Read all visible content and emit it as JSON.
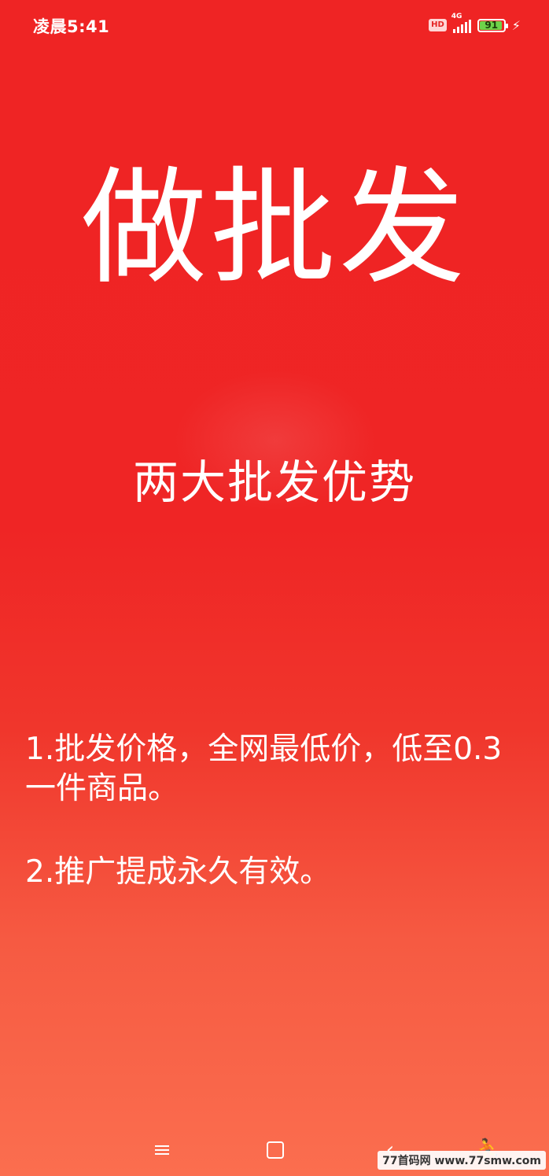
{
  "status_bar": {
    "time": "凌晨5:41",
    "hd_label": "HD",
    "network": "4G",
    "battery_level": "91"
  },
  "content": {
    "headline": "做批发",
    "subtitle": "两大批发优势",
    "points": [
      "1.批发价格，全网最低价，低至0.3一件商品。",
      "2.推广提成永久有效。"
    ]
  },
  "watermark": "77首码网 www.77smw.com",
  "icons": {
    "status": [
      "hd-icon",
      "signal-icon",
      "battery-icon",
      "charging-icon"
    ],
    "navigation": [
      "menu-icon",
      "home-icon",
      "back-icon",
      "accessibility-icon"
    ]
  },
  "colors": {
    "background_top": "#ef2424",
    "background_bottom": "#fb6e4f",
    "text": "#ffffff",
    "battery_fill": "#6ed34a"
  }
}
